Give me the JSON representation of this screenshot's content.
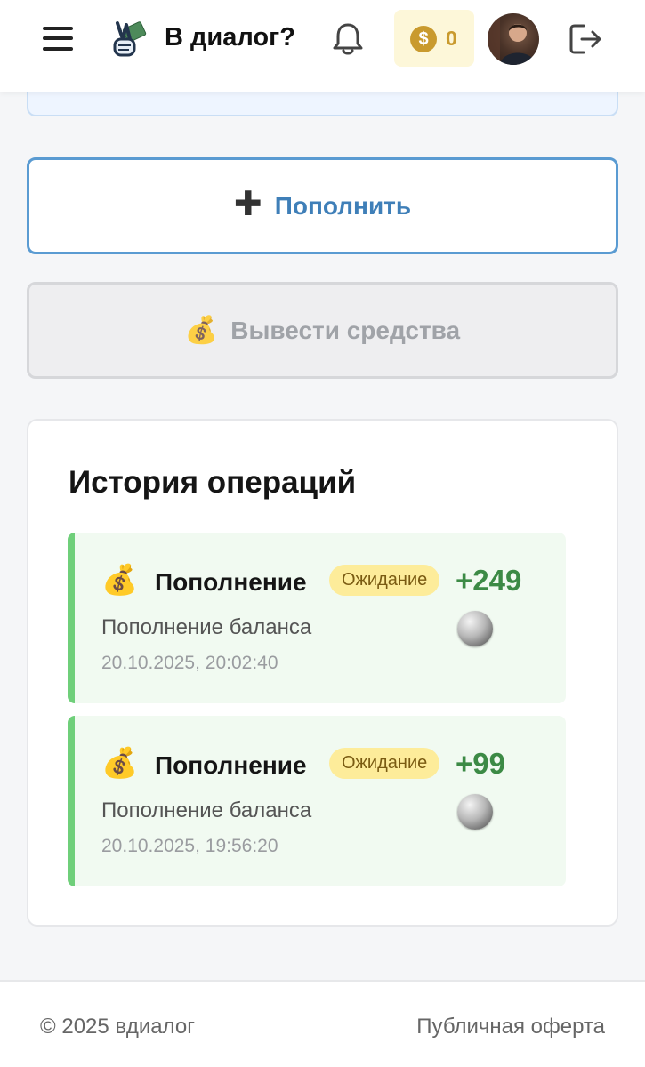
{
  "header": {
    "title": "В диалог?",
    "coins_balance": "0",
    "coin_symbol": "$"
  },
  "actions": {
    "topup_label": "Пополнить",
    "withdraw_label": "Вывести средства"
  },
  "history": {
    "title": "История операций",
    "operations": [
      {
        "icon": "💰",
        "name": "Пополнение",
        "status": "Ожидание",
        "amount": "+249",
        "description": "Пополнение баланса",
        "datetime": "20.10.2025, 20:02:40"
      },
      {
        "icon": "💰",
        "name": "Пополнение",
        "status": "Ожидание",
        "amount": "+99",
        "description": "Пополнение баланса",
        "datetime": "20.10.2025, 19:56:20"
      }
    ]
  },
  "footer": {
    "copyright": "© 2025 вдиалог",
    "offer_link": "Публичная оферта"
  },
  "colors": {
    "accent_blue": "#5a9bd2",
    "coin_gold": "#c99a2e",
    "success_green": "#3c8a45",
    "pending_yellow": "#fdec9a"
  }
}
